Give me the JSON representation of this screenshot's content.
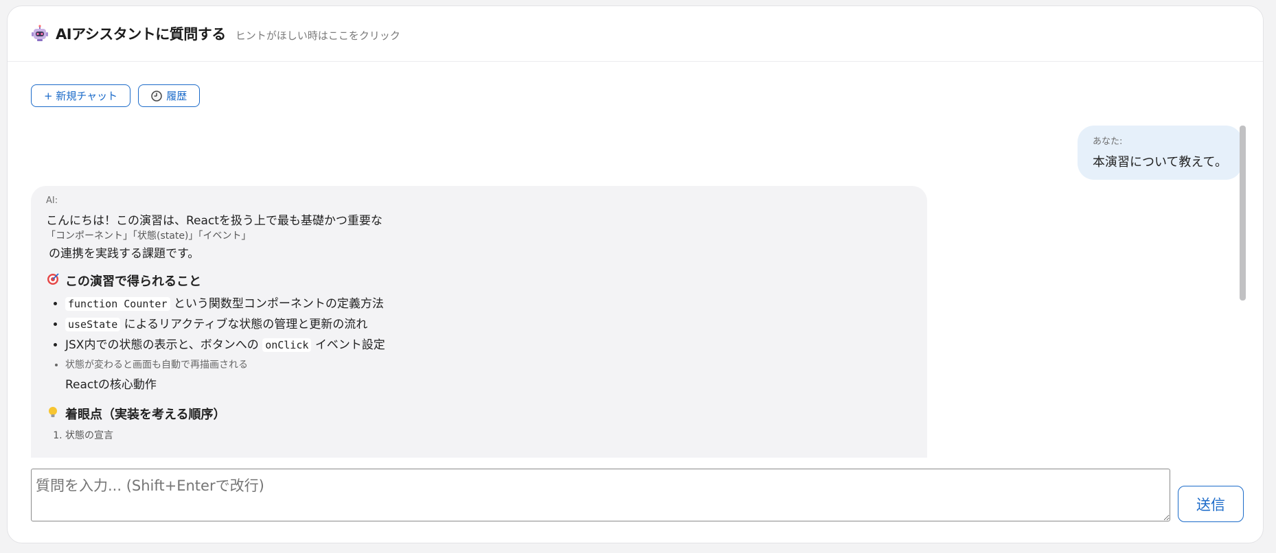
{
  "header": {
    "icon": "robot-icon",
    "title": "AIアシスタントに質問する",
    "hint": "ヒントがほしい時はここをクリック"
  },
  "toolbar": {
    "new_chat_label": "+ 新規チャット",
    "history_label": "履歴",
    "history_icon": "clock-icon"
  },
  "messages": {
    "user": {
      "label": "あなた:",
      "text": "本演習について教えて。"
    },
    "ai": {
      "label": "AI:",
      "intro": "こんにちは！この演習は、Reactを扱う上で最も基礎かつ重要な",
      "keywords": "「コンポーネント」「状態(state)」「イベント」",
      "intro_end": "の連携を実践する課題です。",
      "section1_icon": "target-icon",
      "section1_title": "この演習で得られること",
      "bullets": [
        {
          "code": "function Counter",
          "text": "という関数型コンポーネントの定義方法"
        },
        {
          "code": "useState",
          "text": "によるリアクティブな状態の管理と更新の流れ"
        },
        {
          "pre": "JSX内での状態の表示と、ボタンへの",
          "code": "onClick",
          "text": "イベント設定"
        },
        {
          "text": "状態が変わると画面も自動で再描画される"
        }
      ],
      "bullet4_sub": "Reactの核心動作",
      "section2_icon": "lightbulb-icon",
      "section2_title": "着眼点（実装を考える順序）",
      "ordered": [
        "状態の宣言"
      ]
    }
  },
  "input": {
    "placeholder": "質問を入力... (Shift+Enterで改行)"
  },
  "send_label": "送信",
  "colors": {
    "accent": "#1a6ac9",
    "user_bubble": "#e6f0fa",
    "ai_bubble": "#f3f3f5"
  }
}
